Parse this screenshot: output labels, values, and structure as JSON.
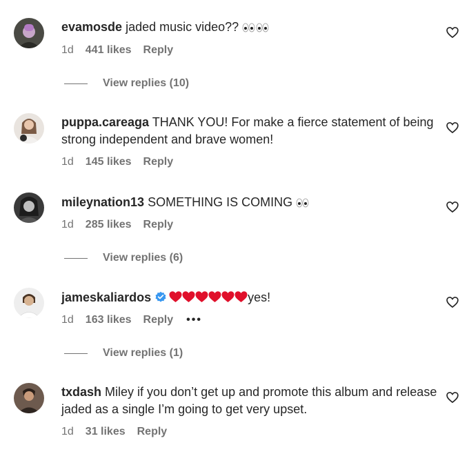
{
  "colors": {
    "text": "#262626",
    "muted": "#737373",
    "verified": "#3897f0",
    "heart_emoji": "#e0102b"
  },
  "comments": [
    {
      "username": "evamosde",
      "text": "jaded music video??",
      "emoji": "eyes-eyes",
      "time": "1d",
      "likes": "441 likes",
      "reply": "Reply",
      "view_replies": "View replies (10)"
    },
    {
      "username": "puppa.careaga",
      "text": "THANK YOU! For make a fierce statement of being strong independent and brave women!",
      "time": "1d",
      "likes": "145 likes",
      "reply": "Reply"
    },
    {
      "username": "mileynation13",
      "text": "SOMETHING IS COMING",
      "emoji": "eyes",
      "time": "1d",
      "likes": "285 likes",
      "reply": "Reply",
      "view_replies": "View replies (6)"
    },
    {
      "username": "jameskaliardos",
      "verified": true,
      "emoji": "red-heart x6",
      "text": "yes!",
      "time": "1d",
      "likes": "163 likes",
      "reply": "Reply",
      "more": "•••",
      "view_replies": "View replies (1)"
    },
    {
      "username": "txdash",
      "text": "Miley if you don’t get up and promote this album and release jaded as a single I’m going to get very upset.",
      "time": "1d",
      "likes": "31 likes",
      "reply": "Reply"
    }
  ]
}
